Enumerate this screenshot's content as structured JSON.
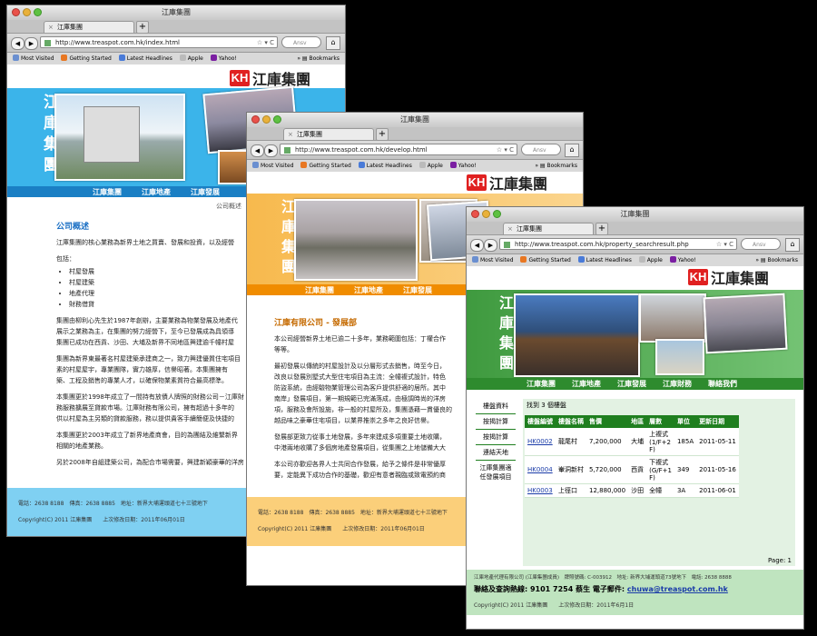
{
  "browser": {
    "back": "◀",
    "forward": "▶",
    "search_placeholder": "Ansv",
    "home": "⌂",
    "bookmarks": [
      "Most Visited",
      "Getting Started",
      "Latest Headlines",
      "Apple",
      "Yahoo!"
    ],
    "bookmarks_menu": "Bookmarks"
  },
  "windows": {
    "w1": {
      "title": "江庫集團",
      "tab": "江庫集團",
      "url": "http://www.treaspot.com.hk/index.html",
      "brand": "江庫集團",
      "vertical": "江庫集團",
      "menu": [
        "江庫集團",
        "江庫地產",
        "江庫發展"
      ],
      "breadcrumb": "公司概述",
      "heading": "公司概述",
      "paragraphs": [
        "江庫集團的核心業務為新界土地之買賣、發展和投資，以及經營",
        "包括："
      ],
      "bullets": [
        "村屋發展",
        "村屋建築",
        "地產代理",
        "財務借貸"
      ],
      "more": [
        "集團由柳利心先生於1987年創辦，主要業務為物業發展及地產代",
        "展示之業務為主，在集團的努力經營下，至今已發展成為具領導",
        "集團已成功在西貢、沙田、大埔及新界不同地區興建逾千幢村屋",
        "集團為新界東最著名村屋建築承建商之一，致力興建優質住宅項目",
        "素的村屋屋宇，專業團隊，實力雄厚，信譽昭著。本集團擁有",
        "築、工程及銷售的專業人才，以確保物業素質符合最高標準。",
        "本集團更於1998年成立了一間持有放債人牌照的財務公司－江庫財",
        "務服務擴展至貸款市場。江庫財務有限公司，擁有超過十多年的",
        "供以村屋為主另類的貸款服務，務以提供貴客手續簡便及快捷的",
        "本集團更於2003年成立了新界地產商會，目的為團結及維繫新界",
        "相關的地產業務。",
        "另於2008年自組建築公司，為配合市場需要，興建新穎豪華的洋房"
      ],
      "footer_phone": "電話：2638 8188　傳真：2638 8885　地址：新界大埔運頭道七十三號地下",
      "footer_copy": "Copyright(C) 2011 江庫集團　　上次修改日期：2011年06月01日"
    },
    "w2": {
      "title": "江庫集團",
      "tab": "江庫集團",
      "url": "http://www.treaspot.com.hk/develop.html",
      "brand": "江庫集團",
      "vertical": "江庫集團",
      "menu": [
        "江庫集團",
        "江庫地產",
        "江庫發展"
      ],
      "heading": "江庫有限公司 - 發展部",
      "paragraphs": [
        "本公司經營新界土地已逾二十多年，業務範圍包括：丁權合作",
        "等等。",
        "最初發展以傳統的村屋設計及以分層形式去銷售，時至今日，",
        "改良以發展別墅式大型住宅項目為主流：全幢複式設計，特色",
        "防盜系統，由經驗物業管理公司為客戶提供舒適的居所。其中",
        "南岸」發展項目，第一期規範已完滿落成，由極調時尚的洋房",
        "項，服務及會所設施，非一般的村屋所及，集團憑藉一貫優良的",
        "越品味之豪華住宅項目，以業界推崇之多年之良好信譽。",
        "發展部更致力從事土地發展，多年來建成多項重要土地收購，",
        "中港兩地收購了多個房地產發展項目，從集團之上地儲備大大",
        "本公司亦歡迎各界人士共同合作發展，給予之條件是非常優厚",
        "要，定能異下成功合作的基礎，歡迎有意者親臨或致電預約商"
      ],
      "footer_phone": "電話：2638 8188　傳真：2638 8885　地址：新界大埔運頭道七十三號地下",
      "footer_copy": "Copyright(C) 2011 江庫集團　　上次修改日期：2011年06月01日"
    },
    "w3": {
      "title": "江庫集團",
      "tab": "江庫集團",
      "url": "http://www.treaspot.com.hk/property_searchresult.php",
      "brand": "江庫集團",
      "vertical": "江庫集團",
      "menu": [
        "江庫集團",
        "江庫地產",
        "江庫發展",
        "江庫財務",
        "聯絡我們"
      ],
      "sidenav": [
        "樓盤資料",
        "按揭計算",
        "按揭計算",
        "連結天地",
        "江庫集團適任發展項目"
      ],
      "result_count": "找到 3 個樓盤",
      "table_headers": [
        "樓盤編號",
        "樓盤名稱",
        "售價",
        "地區",
        "層數",
        "單位",
        "更新日期"
      ],
      "rows": [
        [
          "HK0002",
          "龍尾村",
          "7,200,000",
          "大埔",
          "上複式 (1/F+2 F)",
          "185A",
          "2011-05-11"
        ],
        [
          "HK0004",
          "輋洞新村",
          "5,720,000",
          "西貢",
          "下複式 (G/F+1 F)",
          "349",
          "2011-05-16"
        ],
        [
          "HK0003",
          "上徑口",
          "12,880,000",
          "沙田",
          "全幢",
          "3A",
          "2011-06-01"
        ]
      ],
      "page": "Page: 1",
      "footer_line1": "江庫地產代理有限公司 (江庫集團成員)　牌照號碼: C-003912　地址: 新界大埔運頭道73號地下　電話: 2638 8888",
      "hotline": "聯絡及查詢熱線: 9101 7254 蔡生 電子郵件:",
      "email": "chuwa@treaspot.com.hk",
      "footer_copy": "Copyright(C) 2011 江庫集團　　上次修改日期：2011年6月1日"
    }
  },
  "colors": {
    "w1_accent": "#3bb4ea",
    "w2_accent": "#f5a623",
    "w3_accent": "#2e8b2e"
  }
}
